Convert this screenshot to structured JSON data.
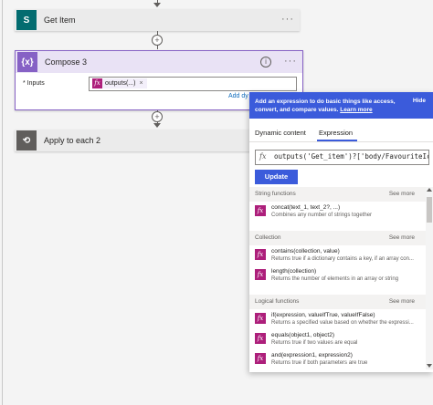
{
  "flow": {
    "get_item": {
      "title": "Get Item",
      "more": "···"
    },
    "compose": {
      "title": "Compose 3",
      "info": "i",
      "more": "···",
      "inputs_label": "* Inputs",
      "token_label": "outputs(...)",
      "token_remove": "×",
      "add_dynamic": "Add dy"
    },
    "apply": {
      "title": "Apply to each 2"
    },
    "plus": "+"
  },
  "panel": {
    "header_text": "Add an expression to do basic things like access, convert, and compare values.",
    "learn_more": "Learn more",
    "hide": "Hide",
    "tabs": [
      "Dynamic content",
      "Expression"
    ],
    "active_tab": "Expression",
    "expression_value": "outputs('Get_item')?['body/FavouriteIceCre",
    "fx": "fx",
    "update_label": "Update",
    "sections": [
      {
        "title": "String functions",
        "see_more": "See more",
        "items": [
          {
            "name": "concat(text_1, text_2?, ...)",
            "desc": "Combines any number of strings together"
          }
        ]
      },
      {
        "title": "Collection",
        "see_more": "See more",
        "items": [
          {
            "name": "contains(collection, value)",
            "desc": "Returns true if a dictionary contains a key, if an array con..."
          },
          {
            "name": "length(collection)",
            "desc": "Returns the number of elements in an array or string"
          }
        ]
      },
      {
        "title": "Logical functions",
        "see_more": "See more",
        "items": [
          {
            "name": "if(expression, valueIfTrue, valueIfFalse)",
            "desc": "Returns a specified value based on whether the expressi..."
          },
          {
            "name": "equals(object1, object2)",
            "desc": "Returns true if two values are equal"
          },
          {
            "name": "and(expression1, expression2)",
            "desc": "Returns true if both parameters are true"
          }
        ]
      }
    ]
  },
  "colors": {
    "accent": "#3b5bdb",
    "compose_purple": "#8661c5",
    "fx_magenta": "#ad1f7b",
    "sharepoint_teal": "#036c70"
  }
}
